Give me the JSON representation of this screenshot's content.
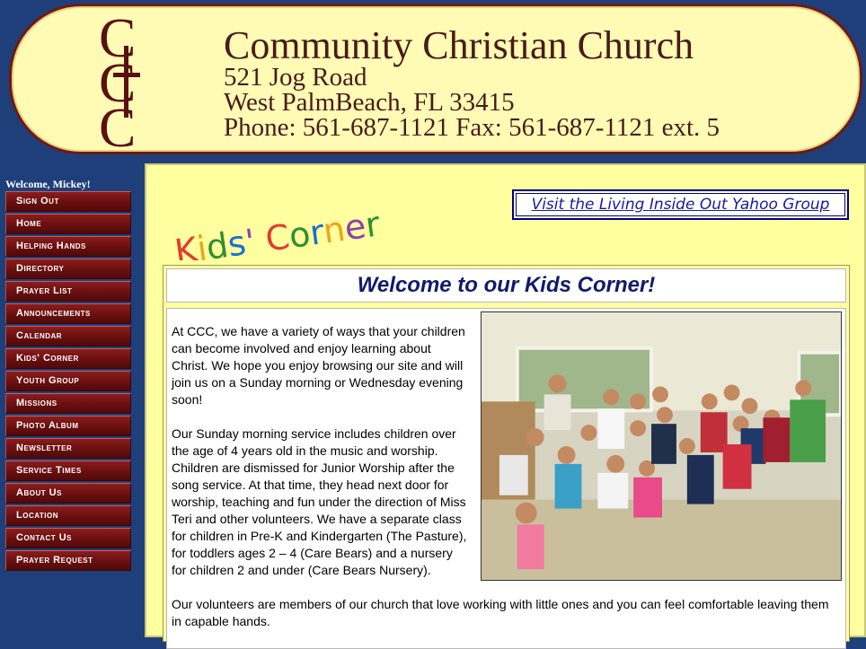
{
  "header": {
    "church_name": "Community Christian Church",
    "address_line1": "521 Jog Road",
    "address_line2": "West PalmBeach, FL 33415",
    "phone_line": "Phone:  561-687-1121 Fax: 561-687-1121 ext. 5",
    "logo_letters": "CCC"
  },
  "sidebar": {
    "welcome": "Welcome, Mickey!",
    "items": [
      {
        "label": "Sign Out"
      },
      {
        "label": "Home"
      },
      {
        "label": "Helping Hands"
      },
      {
        "label": "Directory"
      },
      {
        "label": "Prayer List"
      },
      {
        "label": "Announcements"
      },
      {
        "label": "Calendar"
      },
      {
        "label": "Kids' Corner"
      },
      {
        "label": "Youth Group"
      },
      {
        "label": "Missions"
      },
      {
        "label": "Photo Album"
      },
      {
        "label": "Newsletter"
      },
      {
        "label": "Service Times"
      },
      {
        "label": "About Us"
      },
      {
        "label": "Location"
      },
      {
        "label": "Contact Us"
      },
      {
        "label": "Prayer Request"
      }
    ]
  },
  "main": {
    "page_title": "Kids' Corner",
    "yahoo_link": "Visit the Living Inside Out Yahoo Group",
    "heading": "Welcome to our Kids Corner!",
    "paragraph1": "At CCC, we have a variety of ways that your children can become involved and enjoy learning about Christ. We hope you enjoy browsing our site and will join us on a Sunday morning or Wednesday evening soon!",
    "paragraph2": "Our Sunday morning service includes children over the age of 4 years old in the music and worship. Children are dismissed for Junior Worship after the song service. At that time, they head next door for worship, teaching and fun under the direction of Miss Teri and other volunteers. We have a separate class for children in Pre-K and Kindergarten (The Pasture), for toddlers ages 2 – 4 (Care Bears) and a nursery for children 2 and under (Care Bears Nursery).",
    "paragraph3": "Our volunteers are members of our church that love working with little ones and you can feel comfortable leaving them in capable hands."
  },
  "colors": {
    "page_background": "#1f3f7a",
    "banner_background": "#fffbb4",
    "nav_button": "#6a0f0f",
    "panel_background": "#ffff9f",
    "heading_text": "#111a6e"
  }
}
